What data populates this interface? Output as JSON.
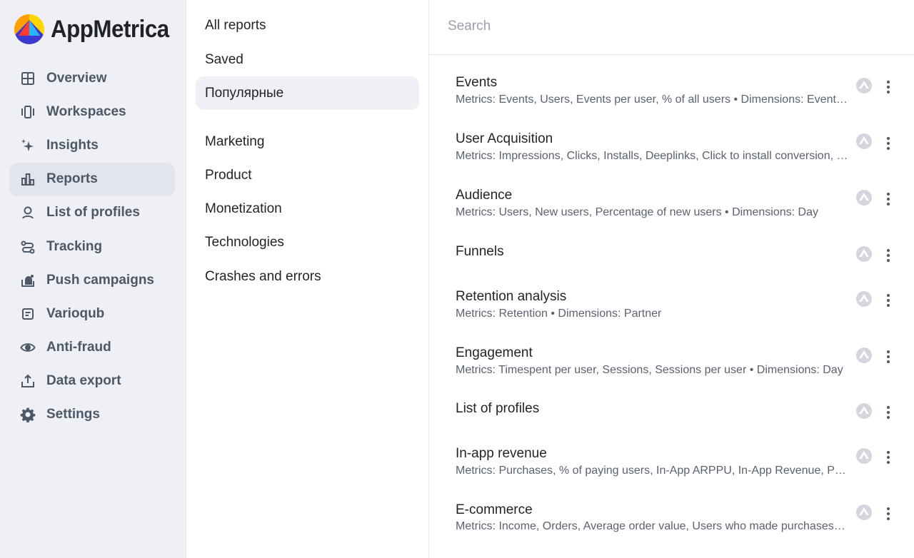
{
  "brand": {
    "name": "AppMetrica"
  },
  "sidebar": {
    "items": [
      {
        "label": "Overview",
        "icon": "grid-icon"
      },
      {
        "label": "Workspaces",
        "icon": "workspaces-icon"
      },
      {
        "label": "Insights",
        "icon": "sparkle-icon"
      },
      {
        "label": "Reports",
        "icon": "bar-chart-icon",
        "active": true
      },
      {
        "label": "List of profiles",
        "icon": "person-icon"
      },
      {
        "label": "Tracking",
        "icon": "route-icon"
      },
      {
        "label": "Push campaigns",
        "icon": "push-bell-icon"
      },
      {
        "label": "Varioqub",
        "icon": "document-icon"
      },
      {
        "label": "Anti-fraud",
        "icon": "eye-icon"
      },
      {
        "label": "Data export",
        "icon": "upload-icon"
      },
      {
        "label": "Settings",
        "icon": "gear-icon"
      }
    ]
  },
  "categories": {
    "items": [
      {
        "label": "All reports"
      },
      {
        "label": "Saved"
      },
      {
        "label": "Популярные",
        "active": true
      },
      {
        "label": "Marketing"
      },
      {
        "label": "Product"
      },
      {
        "label": "Monetization"
      },
      {
        "label": "Technologies"
      },
      {
        "label": "Crashes and errors"
      }
    ]
  },
  "search": {
    "placeholder": "Search"
  },
  "reports": [
    {
      "title": "Events",
      "description": "Metrics: Events, Users, Events per user, % of all users • Dimensions: Event, Partner"
    },
    {
      "title": "User Acquisition",
      "description": "Metrics: Impressions, Clicks, Installs, Deeplinks, Click to install conversion, Sessions"
    },
    {
      "title": "Audience",
      "description": "Metrics: Users, New users, Percentage of new users • Dimensions: Day"
    },
    {
      "title": "Funnels",
      "description": ""
    },
    {
      "title": "Retention analysis",
      "description": "Metrics: Retention • Dimensions: Partner"
    },
    {
      "title": "Engagement",
      "description": "Metrics: Timespent per user, Sessions, Sessions per user • Dimensions: Day"
    },
    {
      "title": "List of profiles",
      "description": ""
    },
    {
      "title": "In-app revenue",
      "description": "Metrics: Purchases, % of paying users, In-App ARPPU, In-App Revenue, Purchases per user"
    },
    {
      "title": "E-commerce",
      "description": "Metrics: Income, Orders, Average order value, Users who made purchases, Purchases per user"
    }
  ],
  "colors": {
    "sidebar_bg": "#eef0f5",
    "active_bg": "#e2e5ec",
    "text_primary": "#1f2328",
    "text_secondary": "#5a6270",
    "nav_text": "#4d5866",
    "badge": "#d3d6dc"
  }
}
